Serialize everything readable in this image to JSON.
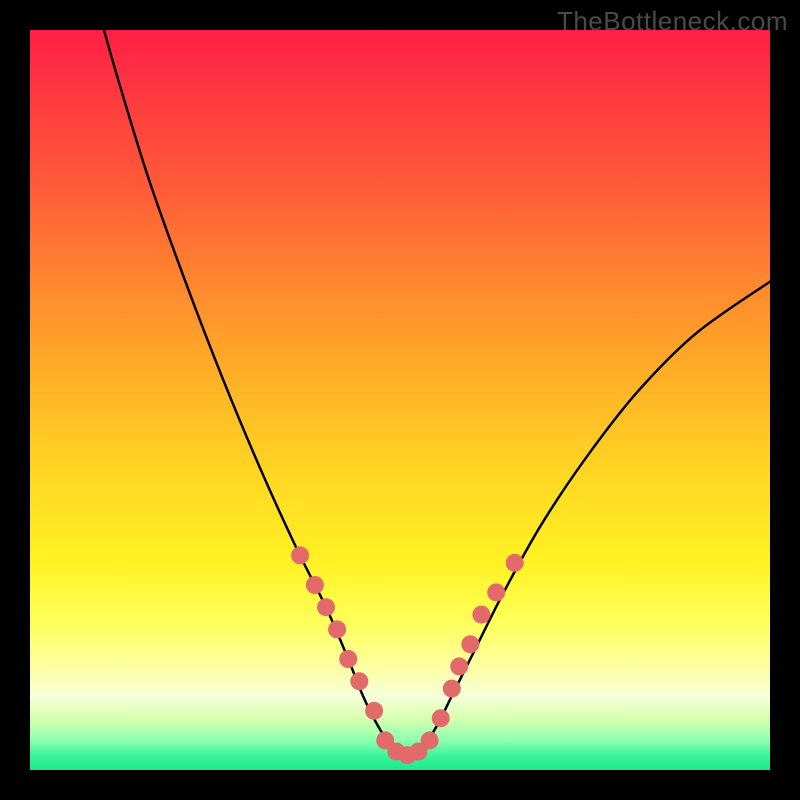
{
  "watermark": "TheBottleneck.com",
  "colors": {
    "background": "#000000",
    "curve": "#000000",
    "marker": "#e36a6a",
    "gradient_top": "#ff1f47",
    "gradient_bottom": "#1be88e"
  },
  "chart_data": {
    "type": "line",
    "title": "",
    "xlabel": "",
    "ylabel": "",
    "xlim": [
      0,
      100
    ],
    "ylim": [
      0,
      100
    ],
    "grid": false,
    "legend": false,
    "series": [
      {
        "name": "curve",
        "x": [
          10,
          12,
          16,
          21,
          26,
          31,
          36,
          40,
          43,
          45,
          47,
          49,
          51,
          53,
          55,
          57,
          60,
          64,
          69,
          75,
          82,
          90,
          100
        ],
        "y": [
          100,
          93,
          80,
          66,
          53,
          41,
          30,
          22,
          15,
          10,
          6,
          3,
          2,
          3,
          6,
          10,
          16,
          24,
          33,
          42,
          51,
          59,
          66
        ]
      }
    ],
    "markers": {
      "name": "dots",
      "x": [
        36.5,
        38.5,
        40,
        41.5,
        43,
        44.5,
        46.5,
        48,
        49.5,
        51,
        52.5,
        54,
        55.5,
        57,
        58,
        59.5,
        61,
        63,
        65.5
      ],
      "y": [
        29,
        25,
        22,
        19,
        15,
        12,
        8,
        4,
        2.5,
        2,
        2.5,
        4,
        7,
        11,
        14,
        17,
        21,
        24,
        28
      ]
    }
  }
}
